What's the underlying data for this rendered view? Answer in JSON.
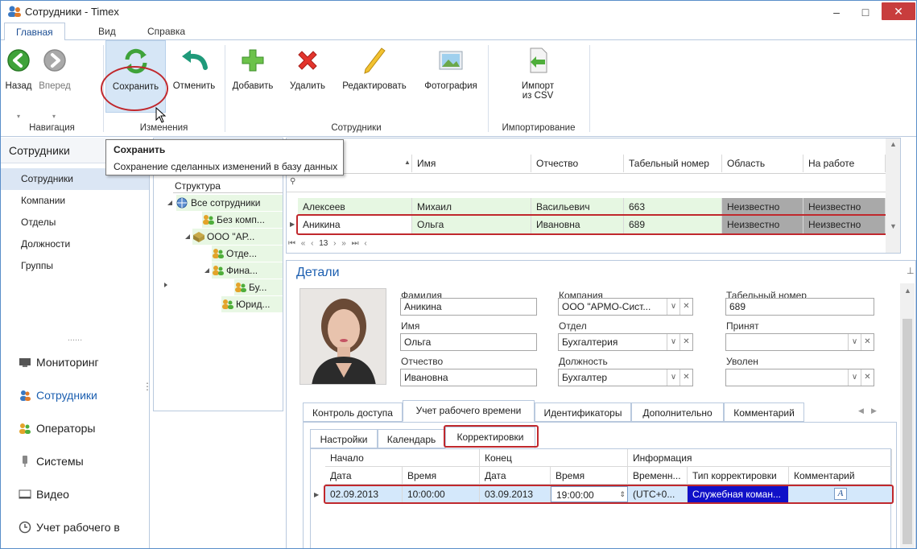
{
  "window": {
    "title": "Сотрудники - Timex",
    "min": "–",
    "max": "□",
    "close": "✕"
  },
  "ribbon_tabs": [
    "Главная",
    "Вид",
    "Справка"
  ],
  "ribbon": {
    "back": "Назад",
    "forward": "Вперед",
    "save": "Сохранить",
    "cancel": "Отменить",
    "add": "Добавить",
    "delete": "Удалить",
    "edit": "Редактировать",
    "photo": "Фотография",
    "import_line1": "Импорт",
    "import_line2": "из CSV",
    "groups": {
      "nav": "Навигация",
      "changes": "Изменения",
      "employees": "Сотрудники",
      "import": "Импортирование"
    }
  },
  "tooltip": {
    "title": "Сохранить",
    "text": "Сохранение сделанных изменений в базу данных"
  },
  "leftnav": {
    "header": "Сотрудники",
    "items": [
      "Сотрудники",
      "Компании",
      "Отделы",
      "Должности",
      "Группы"
    ],
    "dots": "......",
    "big": [
      "Мониторинг",
      "Сотрудники",
      "Операторы",
      "Системы",
      "Видео",
      "Учет рабочего в"
    ]
  },
  "tree": {
    "header_tail": "к",
    "header": "Структура",
    "nodes": [
      "Все сотрудники",
      "Без комп...",
      "ООО \"АР...",
      "Отде...",
      "Фина...",
      "Бу...",
      "Юрид..."
    ]
  },
  "grid": {
    "columns": [
      "Имя",
      "Отчество",
      "Табельный номер",
      "Область",
      "На работе"
    ],
    "rows": [
      [
        "Алексеев",
        "Михаил",
        "Васильевич",
        "663",
        "Неизвестно",
        "Неизвестно"
      ],
      [
        "Аникина",
        "Ольга",
        "Ивановна",
        "689",
        "Неизвестно",
        "Неизвестно"
      ]
    ],
    "nav_page": "13"
  },
  "details": {
    "title": "Детали",
    "pin": "⊥",
    "labels": {
      "lastname": "Фамилия",
      "company": "Компания",
      "tabnum": "Табельный номер",
      "firstname": "Имя",
      "dept": "Отдел",
      "hired": "Принят",
      "patronymic": "Отчество",
      "position": "Должность",
      "fired": "Уволен"
    },
    "values": {
      "lastname": "Аникина",
      "company": "ООО \"АРМО-Сист...",
      "tabnum": "689",
      "firstname": "Ольга",
      "dept": "Бухгалтерия",
      "hired": "",
      "patronymic": "Ивановна",
      "position": "Бухгалтер",
      "fired": ""
    },
    "tabs": [
      "Контроль доступа",
      "Учет рабочего времени",
      "Идентификаторы",
      "Дополнительно",
      "Комментарий"
    ],
    "subtabs": [
      "Настройки",
      "Календарь",
      "Корректировки"
    ],
    "corr": {
      "group_start": "Начало",
      "group_end": "Конец",
      "group_info": "Информация",
      "cols": [
        "Дата",
        "Время",
        "Дата",
        "Время",
        "Временн...",
        "Тип корректировки",
        "Комментарий"
      ],
      "row": [
        "02.09.2013",
        "10:00:00",
        "03.09.2013",
        "19:00:00",
        "(UTC+0...",
        "Служебная коман...",
        "A"
      ]
    }
  }
}
